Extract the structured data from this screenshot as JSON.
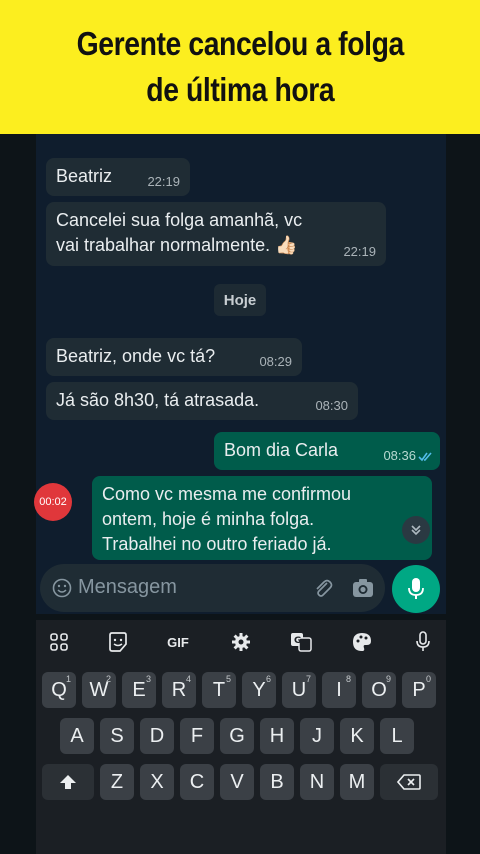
{
  "banner": {
    "line1": "Gerente cancelou a folga",
    "line2": "de última hora"
  },
  "messages": [
    {
      "dir": "in",
      "text": "Beatriz",
      "time": "22:19"
    },
    {
      "dir": "in",
      "text": "Cancelei sua folga amanhã, vc vai trabalhar normalmente. 👍🏻",
      "time": "22:19"
    },
    {
      "dir": "in",
      "text": "Beatriz, onde vc tá?",
      "time": "08:29"
    },
    {
      "dir": "in",
      "text": "Já são 8h30, tá atrasada.",
      "time": "08:30"
    },
    {
      "dir": "out",
      "text": "Bom dia Carla",
      "time": "08:36"
    },
    {
      "dir": "out",
      "text": "Como vc mesma me confirmou ontem, hoje é minha folga. Trabalhei no outro feriado já.",
      "time": ""
    }
  ],
  "day_separator": "Hoje",
  "recording_timer": "00:02",
  "composer": {
    "placeholder": "Mensagem",
    "icons": [
      "emoji-icon",
      "attach-icon",
      "camera-icon",
      "mic-icon"
    ]
  },
  "keyboard": {
    "toolbar": [
      "apps-grid-icon",
      "sticker-icon",
      "GIF",
      "settings-icon",
      "translate-icon",
      "palette-icon",
      "mic-icon"
    ],
    "gif_label": "GIF",
    "row1": [
      "Q",
      "W",
      "E",
      "R",
      "T",
      "Y",
      "U",
      "I",
      "O",
      "P"
    ],
    "row1_sup": [
      "1",
      "2",
      "3",
      "4",
      "5",
      "6",
      "7",
      "8",
      "9",
      "0"
    ],
    "row2": [
      "A",
      "S",
      "D",
      "F",
      "G",
      "H",
      "J",
      "K",
      "L"
    ],
    "row3": [
      "Z",
      "X",
      "C",
      "V",
      "B",
      "N",
      "M"
    ]
  },
  "colors": {
    "banner": "#fcee1f",
    "incoming_bubble": "#1f2c34",
    "outgoing_bubble": "#005c4b",
    "accent": "#00a884",
    "read_ticks": "#53bdeb"
  }
}
